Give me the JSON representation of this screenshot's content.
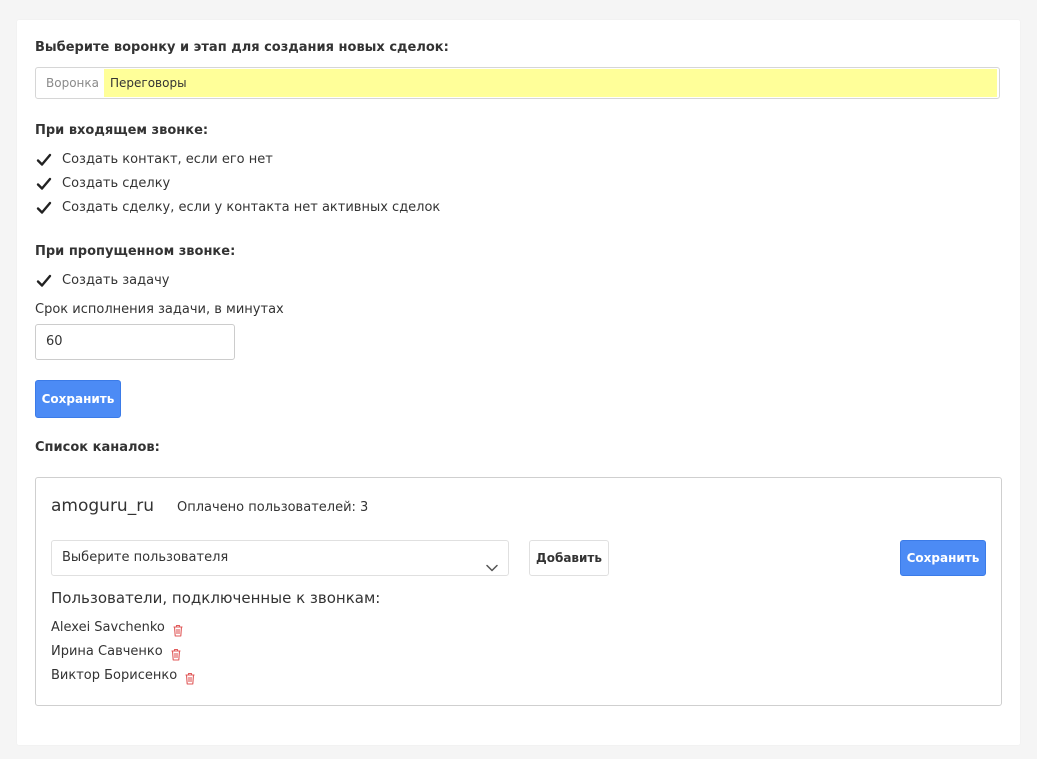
{
  "pipeline_section": {
    "heading": "Выберите воронку и этап для создания новых сделок:",
    "prefix": "Воронка",
    "selected_stage": "Переговоры",
    "highlight_color": "#ffff99"
  },
  "incoming_call": {
    "heading": "При входящем звонке:",
    "options": [
      {
        "label": "Создать контакт, если его нет",
        "checked": true
      },
      {
        "label": "Создать сделку",
        "checked": true
      },
      {
        "label": "Создать сделку, если у контакта нет активных сделок",
        "checked": true
      }
    ]
  },
  "missed_call": {
    "heading": "При пропущенном звонке:",
    "options": [
      {
        "label": "Создать задачу",
        "checked": true
      }
    ],
    "deadline_label": "Срок исполнения задачи, в минутах",
    "deadline_value": "60"
  },
  "save_button_label": "Сохранить",
  "channels": {
    "heading": "Список каналов:",
    "items": [
      {
        "name": "amoguru_ru",
        "paid_users": "Оплачено пользователей: 3",
        "select_placeholder": "Выберите пользователя",
        "add_button": "Добавить",
        "save_button": "Сохранить",
        "connected_heading": "Пользователи, подключенные к звонкам:",
        "users": [
          "Alexei Savchenko",
          "Ирина Савченко",
          "Виктор Борисенко"
        ]
      }
    ]
  },
  "colors": {
    "primary": "#4c8bf5",
    "trash": "#e05a5a",
    "background": "#f5f5f5"
  }
}
